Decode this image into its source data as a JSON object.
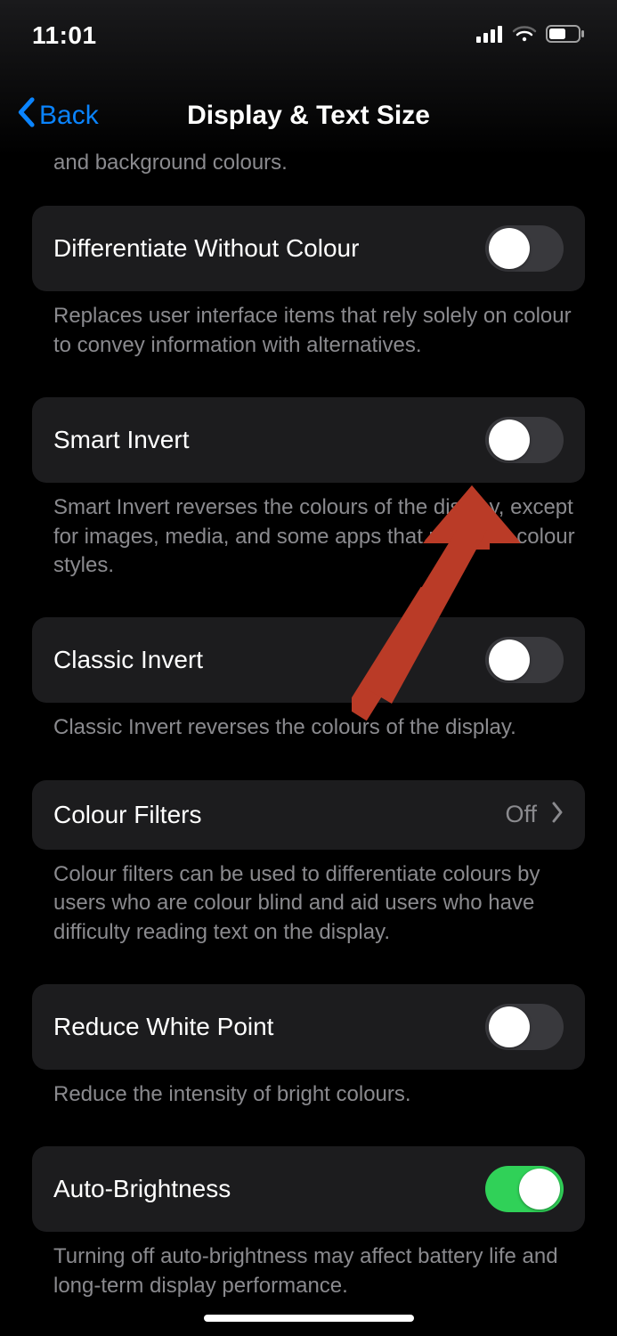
{
  "status": {
    "time": "11:01"
  },
  "nav": {
    "back": "Back",
    "title": "Display & Text Size"
  },
  "partialTop": "and background colours.",
  "rows": {
    "diffColour": {
      "label": "Differentiate Without Colour",
      "footer": "Replaces user interface items that rely solely on colour to convey information with alternatives."
    },
    "smartInvert": {
      "label": "Smart Invert",
      "footer": "Smart Invert reverses the colours of the display, except for images, media, and some apps that use dark colour styles."
    },
    "classicInvert": {
      "label": "Classic Invert",
      "footer": "Classic Invert reverses the colours of the display."
    },
    "colourFilters": {
      "label": "Colour Filters",
      "value": "Off",
      "footer": "Colour filters can be used to differentiate colours by users who are colour blind and aid users who have difficulty reading text on the display."
    },
    "reduceWhitePoint": {
      "label": "Reduce White Point",
      "footer": "Reduce the intensity of bright colours."
    },
    "autoBrightness": {
      "label": "Auto-Brightness",
      "footer": "Turning off auto-brightness may affect battery life and long-term display performance."
    }
  }
}
